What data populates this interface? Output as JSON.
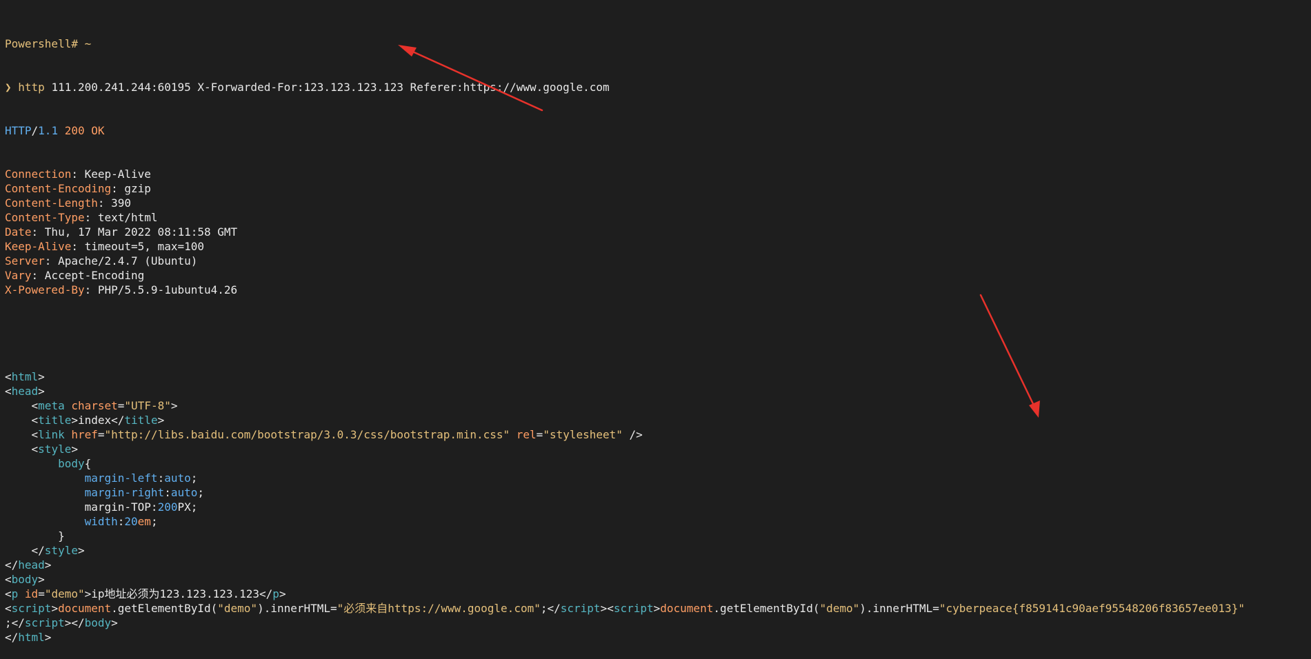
{
  "terminal": {
    "prompt": {
      "label": "Powershell# ~",
      "arrow": "❯",
      "cmd_name": "http",
      "cmd_args": " 111.200.241.244:60195 X-Forwarded-For:123.123.123.123 Referer:https://www.google.com"
    },
    "status_line": {
      "proto": "HTTP",
      "slash": "/",
      "version": "1.1",
      "code": " 200 OK"
    },
    "headers": [
      {
        "name": "Connection",
        "value": "Keep-Alive"
      },
      {
        "name": "Content-Encoding",
        "value": "gzip"
      },
      {
        "name": "Content-Length",
        "value": "390"
      },
      {
        "name": "Content-Type",
        "value": "text/html"
      },
      {
        "name": "Date",
        "value": "Thu, 17 Mar 2022 08:11:58 GMT"
      },
      {
        "name": "Keep-Alive",
        "value": "timeout=5, max=100"
      },
      {
        "name": "Server",
        "value": "Apache/2.4.7 (Ubuntu)"
      },
      {
        "name": "Vary",
        "value": "Accept-Encoding"
      },
      {
        "name": "X-Powered-By",
        "value": "PHP/5.5.9-1ubuntu4.26"
      }
    ],
    "body_lines": [
      [
        {
          "c": "plain",
          "t": "<"
        },
        {
          "c": "tag",
          "t": "html"
        },
        {
          "c": "plain",
          "t": ">"
        }
      ],
      [
        {
          "c": "plain",
          "t": "<"
        },
        {
          "c": "tag",
          "t": "head"
        },
        {
          "c": "plain",
          "t": ">"
        }
      ],
      [
        {
          "c": "plain",
          "t": "    <"
        },
        {
          "c": "tag",
          "t": "meta"
        },
        {
          "c": "plain",
          "t": " "
        },
        {
          "c": "attr",
          "t": "charset"
        },
        {
          "c": "plain",
          "t": "="
        },
        {
          "c": "str",
          "t": "\"UTF-8\""
        },
        {
          "c": "plain",
          "t": ">"
        }
      ],
      [
        {
          "c": "plain",
          "t": "    <"
        },
        {
          "c": "tag",
          "t": "title"
        },
        {
          "c": "plain",
          "t": ">index</"
        },
        {
          "c": "tag",
          "t": "title"
        },
        {
          "c": "plain",
          "t": ">"
        }
      ],
      [
        {
          "c": "plain",
          "t": "    <"
        },
        {
          "c": "tag",
          "t": "link"
        },
        {
          "c": "plain",
          "t": " "
        },
        {
          "c": "attr",
          "t": "href"
        },
        {
          "c": "plain",
          "t": "="
        },
        {
          "c": "str",
          "t": "\"http://libs.baidu.com/bootstrap/3.0.3/css/bootstrap.min.css\""
        },
        {
          "c": "plain",
          "t": " "
        },
        {
          "c": "attr",
          "t": "rel"
        },
        {
          "c": "plain",
          "t": "="
        },
        {
          "c": "str",
          "t": "\"stylesheet\""
        },
        {
          "c": "plain",
          "t": " />"
        }
      ],
      [
        {
          "c": "plain",
          "t": "    <"
        },
        {
          "c": "tag",
          "t": "style"
        },
        {
          "c": "plain",
          "t": ">"
        }
      ],
      [
        {
          "c": "plain",
          "t": "        "
        },
        {
          "c": "tag",
          "t": "body"
        },
        {
          "c": "plain",
          "t": "{"
        }
      ],
      [
        {
          "c": "plain",
          "t": "            "
        },
        {
          "c": "prop",
          "t": "margin-left"
        },
        {
          "c": "plain",
          "t": ":"
        },
        {
          "c": "prop",
          "t": "auto"
        },
        {
          "c": "plain",
          "t": ";"
        }
      ],
      [
        {
          "c": "plain",
          "t": "            "
        },
        {
          "c": "prop",
          "t": "margin-right"
        },
        {
          "c": "plain",
          "t": ":"
        },
        {
          "c": "prop",
          "t": "auto"
        },
        {
          "c": "plain",
          "t": ";"
        }
      ],
      [
        {
          "c": "plain",
          "t": "            margin-TOP:"
        },
        {
          "c": "num",
          "t": "200"
        },
        {
          "c": "plain",
          "t": "PX;"
        }
      ],
      [
        {
          "c": "plain",
          "t": "            "
        },
        {
          "c": "prop",
          "t": "width"
        },
        {
          "c": "plain",
          "t": ":"
        },
        {
          "c": "num",
          "t": "20"
        },
        {
          "c": "unit",
          "t": "em"
        },
        {
          "c": "plain",
          "t": ";"
        }
      ],
      [
        {
          "c": "plain",
          "t": "        }"
        }
      ],
      [
        {
          "c": "plain",
          "t": "    </"
        },
        {
          "c": "tag",
          "t": "style"
        },
        {
          "c": "plain",
          "t": ">"
        }
      ],
      [
        {
          "c": "plain",
          "t": "</"
        },
        {
          "c": "tag",
          "t": "head"
        },
        {
          "c": "plain",
          "t": ">"
        }
      ],
      [
        {
          "c": "plain",
          "t": "<"
        },
        {
          "c": "tag",
          "t": "body"
        },
        {
          "c": "plain",
          "t": ">"
        }
      ],
      [
        {
          "c": "plain",
          "t": "<"
        },
        {
          "c": "tag",
          "t": "p"
        },
        {
          "c": "plain",
          "t": " "
        },
        {
          "c": "attr",
          "t": "id"
        },
        {
          "c": "plain",
          "t": "="
        },
        {
          "c": "str",
          "t": "\"demo\""
        },
        {
          "c": "plain",
          "t": ">ip地址必须为123.123.123.123</"
        },
        {
          "c": "tag",
          "t": "p"
        },
        {
          "c": "plain",
          "t": ">"
        }
      ],
      [
        {
          "c": "plain",
          "t": "<"
        },
        {
          "c": "tag",
          "t": "script"
        },
        {
          "c": "plain",
          "t": ">"
        },
        {
          "c": "attr",
          "t": "document"
        },
        {
          "c": "plain",
          "t": ".getElementById("
        },
        {
          "c": "str",
          "t": "\"demo\""
        },
        {
          "c": "plain",
          "t": ").innerHTML="
        },
        {
          "c": "str",
          "t": "\"必须来自https://www.google.com\""
        },
        {
          "c": "plain",
          "t": ";</"
        },
        {
          "c": "tag",
          "t": "script"
        },
        {
          "c": "plain",
          "t": "><"
        },
        {
          "c": "tag",
          "t": "script"
        },
        {
          "c": "plain",
          "t": ">"
        },
        {
          "c": "attr",
          "t": "document"
        },
        {
          "c": "plain",
          "t": ".getElementById("
        },
        {
          "c": "str",
          "t": "\"demo\""
        },
        {
          "c": "plain",
          "t": ").innerHTML="
        },
        {
          "c": "str",
          "t": "\"cyberpeace{f859141c90aef95548206f83657ee013}\""
        }
      ],
      [
        {
          "c": "plain",
          "t": ";</"
        },
        {
          "c": "tag",
          "t": "script"
        },
        {
          "c": "plain",
          "t": "></"
        },
        {
          "c": "tag",
          "t": "body"
        },
        {
          "c": "plain",
          "t": ">"
        }
      ],
      [
        {
          "c": "plain",
          "t": "</"
        },
        {
          "c": "tag",
          "t": "html"
        },
        {
          "c": "plain",
          "t": ">"
        }
      ]
    ]
  },
  "colors": {
    "background": "#1e1e1e",
    "annotation_arrow": "#e8322b"
  }
}
